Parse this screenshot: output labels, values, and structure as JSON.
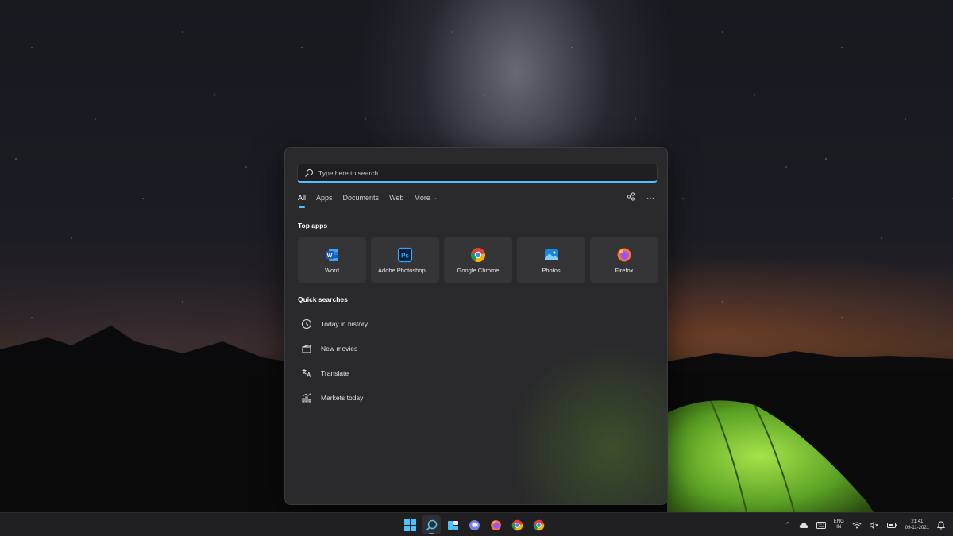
{
  "search": {
    "placeholder": "Type here to search"
  },
  "tabs": [
    {
      "label": "All",
      "active": true
    },
    {
      "label": "Apps"
    },
    {
      "label": "Documents"
    },
    {
      "label": "Web"
    },
    {
      "label": "More"
    }
  ],
  "top_apps": {
    "title": "Top apps",
    "items": [
      {
        "label": "Word",
        "icon": "word-icon"
      },
      {
        "label": "Adobe Photoshop ...",
        "icon": "photoshop-icon"
      },
      {
        "label": "Google Chrome",
        "icon": "chrome-icon"
      },
      {
        "label": "Photos",
        "icon": "photos-icon"
      },
      {
        "label": "Firefox",
        "icon": "firefox-icon"
      }
    ]
  },
  "quick_searches": {
    "title": "Quick searches",
    "items": [
      {
        "label": "Today in history",
        "icon": "clock-icon"
      },
      {
        "label": "New movies",
        "icon": "clapperboard-icon"
      },
      {
        "label": "Translate",
        "icon": "translate-icon"
      },
      {
        "label": "Markets today",
        "icon": "chart-icon"
      }
    ]
  },
  "taskbar": {
    "lang_line1": "ENG",
    "lang_line2": "IN",
    "time": "21:41",
    "date": "09-11-2021"
  },
  "colors": {
    "accent": "#4cc2ff",
    "flyout_bg": "#2a2a2c",
    "tile_bg": "#353537",
    "taskbar_bg": "#202022"
  }
}
